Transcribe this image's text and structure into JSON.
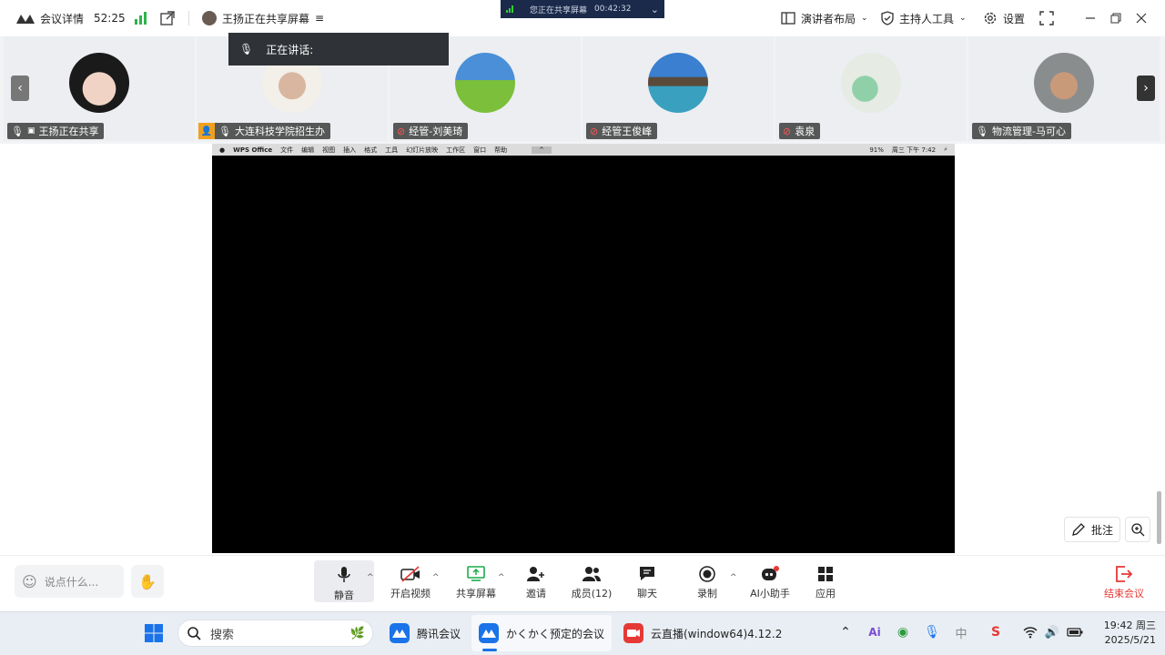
{
  "topbar": {
    "meeting_details": "会议详情",
    "timer": "52:25",
    "sharing_status": "王扬正在共享屏幕",
    "presenter_layout": "演讲者布局",
    "host_tools": "主持人工具",
    "settings": "设置"
  },
  "share_indicator": {
    "text": "您正在共享屏幕",
    "time": "00:42:32"
  },
  "speaking_popup": {
    "label": "正在讲话:"
  },
  "participants": [
    {
      "name": "王扬正在共享",
      "avatar": "photo-woman"
    },
    {
      "name": "大连科技学院招生办",
      "avatar": "photo-bride",
      "host": true
    },
    {
      "name": "经管-刘美琦",
      "avatar": "landscape-green"
    },
    {
      "name": "经管王俊峰",
      "avatar": "landscape-lake"
    },
    {
      "name": "袁泉",
      "avatar": "art-flower"
    },
    {
      "name": "物流管理-马可心",
      "avatar": "photo-person"
    }
  ],
  "shared_screen": {
    "menubar": [
      "WPS Office",
      "文件",
      "编辑",
      "视图",
      "插入",
      "格式",
      "工具",
      "幻灯片放映",
      "工作区",
      "窗口",
      "帮助"
    ],
    "battery": "91%",
    "clock": "周三 下午 7:42"
  },
  "floating": {
    "annotate": "批注"
  },
  "toolbar": {
    "chat_placeholder": "说点什么...",
    "mute": "静音",
    "start_video": "开启视频",
    "share_screen": "共享屏幕",
    "invite": "邀请",
    "members": "成员(12)",
    "chat": "聊天",
    "record": "录制",
    "ai_assistant": "AI小助手",
    "apps": "应用",
    "end_meeting": "结束会议"
  },
  "taskbar": {
    "search": "搜索",
    "apps": [
      {
        "label": "腾讯会议"
      },
      {
        "label": "かくかく预定的会议"
      },
      {
        "label": "云直播(window64)4.12.2"
      }
    ],
    "time": "19:42 周三",
    "date": "2025/5/21",
    "ime": "中"
  },
  "colors": {
    "accent": "#1a73e8",
    "end_red": "#e53935",
    "share_bar": "#1b2a4a"
  }
}
